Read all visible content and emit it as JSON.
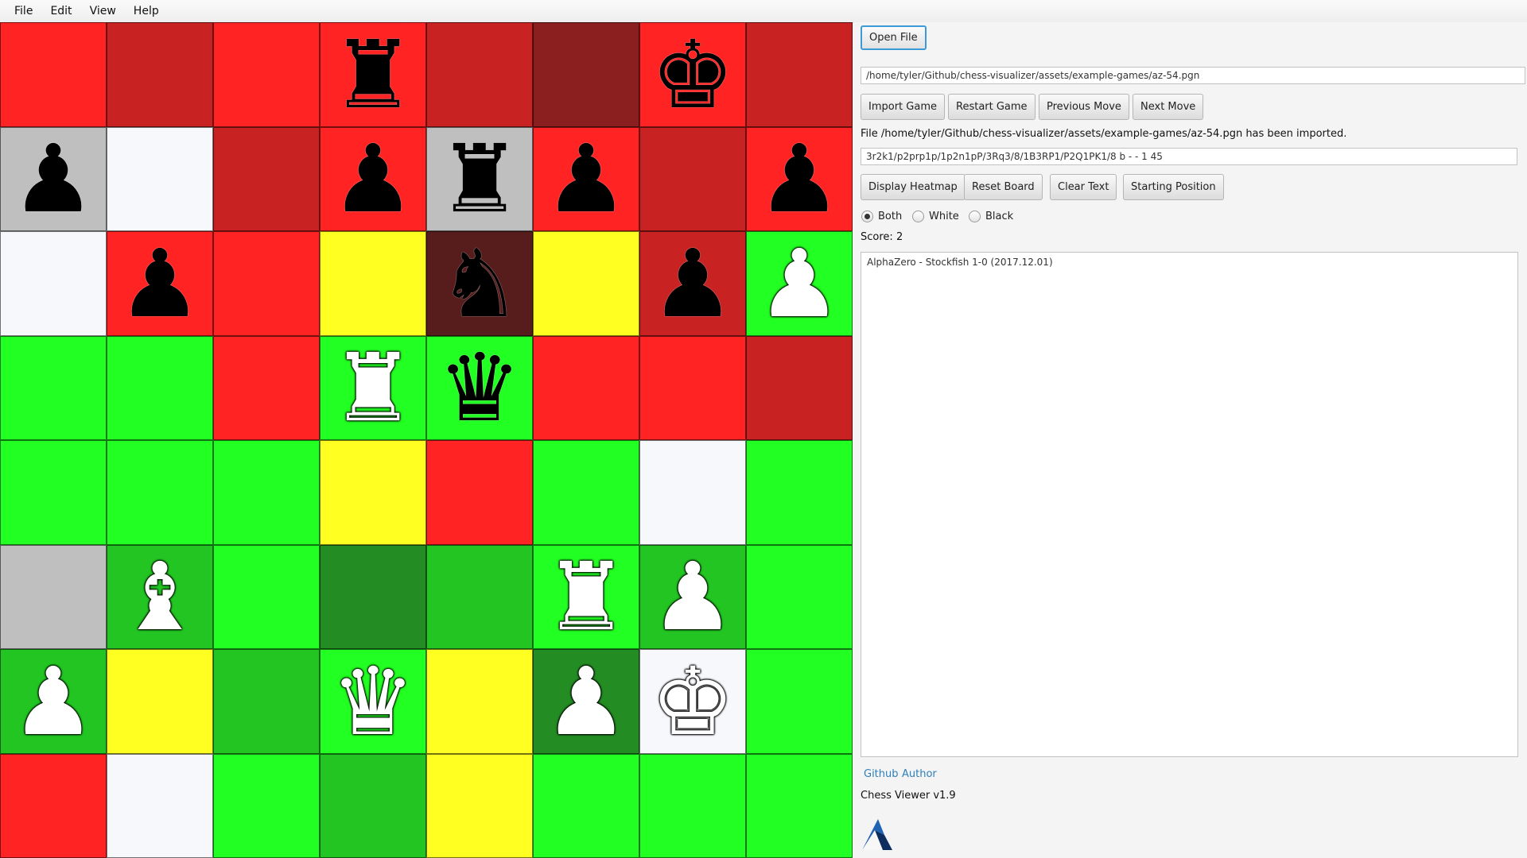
{
  "menu": [
    "File",
    "Edit",
    "View",
    "Help"
  ],
  "board": {
    "colors": {
      "red": "#ff2323",
      "darkred": "#c82222",
      "maroon": "#8b1e1e",
      "grey": "#bfbfbf",
      "whiteish": "#f7f8fc",
      "yellow": "#ffff22",
      "green": "#22ff22",
      "midgreen": "#22c522",
      "darkgreen": "#238c23",
      "brown": "#571c1c"
    },
    "squares": [
      [
        "red",
        "darkred",
        "red",
        "red",
        "darkred",
        "maroon",
        "red",
        "darkred"
      ],
      [
        "grey",
        "whiteish",
        "darkred",
        "red",
        "grey",
        "red",
        "darkred",
        "red"
      ],
      [
        "whiteish",
        "red",
        "red",
        "yellow",
        "brown",
        "yellow",
        "darkred",
        "green"
      ],
      [
        "green",
        "green",
        "red",
        "green",
        "green",
        "red",
        "red",
        "darkred"
      ],
      [
        "green",
        "green",
        "green",
        "yellow",
        "red",
        "green",
        "whiteish",
        "green"
      ],
      [
        "grey",
        "midgreen",
        "green",
        "darkgreen",
        "midgreen",
        "green",
        "midgreen",
        "green"
      ],
      [
        "midgreen",
        "yellow",
        "midgreen",
        "green",
        "yellow",
        "darkgreen",
        "whiteish",
        "green"
      ],
      [
        "red",
        "whiteish",
        "green",
        "midgreen",
        "yellow",
        "green",
        "green",
        "green"
      ]
    ],
    "pieces": [
      [
        "",
        "",
        "",
        "r",
        "",
        "",
        "k",
        ""
      ],
      [
        "p",
        "",
        "",
        "p",
        "r",
        "p",
        "",
        "p"
      ],
      [
        "",
        "p",
        "",
        "",
        "n",
        "",
        "p",
        "P"
      ],
      [
        "",
        "",
        "",
        "R",
        "q",
        "",
        "",
        ""
      ],
      [
        "",
        "",
        "",
        "",
        "",
        "",
        "",
        ""
      ],
      [
        "",
        "B",
        "",
        "",
        "",
        "R",
        "P",
        ""
      ],
      [
        "P",
        "",
        "",
        "Q",
        "",
        "P",
        "K",
        ""
      ],
      [
        "",
        "",
        "",
        "",
        "",
        "",
        "",
        ""
      ]
    ]
  },
  "panel": {
    "open_file": "Open File",
    "file_path": "/home/tyler/Github/chess-visualizer/assets/example-games/az-54.pgn",
    "buttons_row1": [
      "Import Game",
      "Restart Game",
      "Previous Move",
      "Next Move"
    ],
    "status": "File /home/tyler/Github/chess-visualizer/assets/example-games/az-54.pgn has been imported.",
    "fen": "3r2k1/p2prp1p/1p2n1pP/3Rq3/8/1B3RP1/P2Q1PK1/8 b - - 1 45",
    "buttons_row2": [
      "Display Heatmap",
      "Reset Board",
      "Clear Text",
      "Starting Position"
    ],
    "radios": [
      "Both",
      "White",
      "Black"
    ],
    "selected_radio": "Both",
    "score_label": "Score:",
    "score_value": "2",
    "log_text": "AlphaZero - Stockfish 1-0 (2017.12.01)",
    "links": [
      "Github",
      "Author"
    ],
    "version": "Chess Viewer v1.9",
    "logo_color": "#1f63b5"
  }
}
